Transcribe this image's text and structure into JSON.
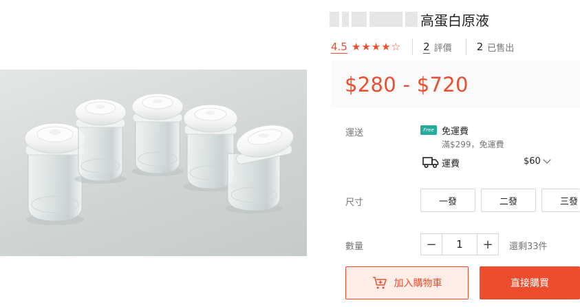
{
  "product": {
    "title": "高蛋白原液",
    "rating": "4.5",
    "stars": [
      "★",
      "★",
      "★",
      "★",
      "☆"
    ],
    "reviews_count": "2",
    "reviews_label": "評價",
    "sold_count": "2",
    "sold_label": "已售出",
    "price": "$280 - $720",
    "image_icon": "product-photo"
  },
  "shipping": {
    "label": "運送",
    "free_badge": "Free",
    "free_title": "免運費",
    "free_condition": "滿$299，免運費",
    "fee_label": "運費",
    "fee_value": "$60"
  },
  "size": {
    "label": "尺寸",
    "options": [
      "一發",
      "二發",
      "三發"
    ]
  },
  "quantity": {
    "label": "數量",
    "minus": "−",
    "value": "1",
    "plus": "+",
    "stock": "還剩33件"
  },
  "actions": {
    "add_to_cart": "加入購物車",
    "buy_now": "直接購買"
  },
  "colors": {
    "accent": "#ee4d2d",
    "free_badge": "#26aa99",
    "price_bg": "#fafafa"
  }
}
